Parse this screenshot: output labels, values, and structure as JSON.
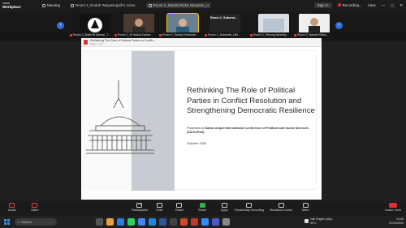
{
  "app": {
    "brand_line1": "zoom",
    "brand_line2": "Workplace"
  },
  "topbar": {
    "meeting_tab": "Meeting",
    "room_tabs": [
      {
        "label": "Room 2_Endah Wayaningsih's scree",
        "active": false
      },
      {
        "label": "Room 2_Nanda Rizka Nasution_U",
        "active": true
      }
    ],
    "sign_in": "Sign in",
    "recording": "Recording...",
    "view": "View"
  },
  "participants": {
    "tiles": [
      {
        "label": ""
      },
      {
        "label": ""
      },
      {
        "label": ""
      },
      {
        "label": "Room 2_Subend..."
      },
      {
        "label": ""
      },
      {
        "label": ""
      }
    ],
    "names": [
      "Room 2_Ratih Bi Abbasi_T...",
      "Room 2_M Haikal Zamar...",
      "Room 2_Sanita Fendorah...",
      "Room 2_Subendri_UIN...",
      "Room 2_Sheong Akorelly...",
      "Room 2_Nanda Rizka..."
    ]
  },
  "share": {
    "doc_title": "Rethinking The Role of Political Parties in Conflic...",
    "doc_sub": "Page 1 / 15",
    "slide": {
      "title": "Rethinking The Role of Political Parties in Conflict Resolution and Strengthening Democratic Resilience",
      "presented_prefix": "Presented at ",
      "conference": "Sanan Ampel International Conference of Political and Social Sciences (SAICoPSS)",
      "date": "October 2025"
    }
  },
  "toolbar": {
    "items": [
      {
        "label": "Audio"
      },
      {
        "label": "Video"
      },
      {
        "label": "Participants",
        "count": "74"
      },
      {
        "label": "Chat"
      },
      {
        "label": "React"
      },
      {
        "label": "Share"
      },
      {
        "label": "Apps"
      },
      {
        "label": "Pause/stop recording"
      },
      {
        "label": "Breakout rooms"
      },
      {
        "label": "More"
      }
    ],
    "leave": "Leave room"
  },
  "taskbar": {
    "search_placeholder": "Search",
    "notification": "Hari Rogam yang...",
    "notification_sub": "30°C",
    "time": "14:36",
    "date": "21/10/2025"
  },
  "colors": {
    "accent": "#2f6fe0",
    "record": "#e03030",
    "slide_title": "#2d2d2d"
  }
}
